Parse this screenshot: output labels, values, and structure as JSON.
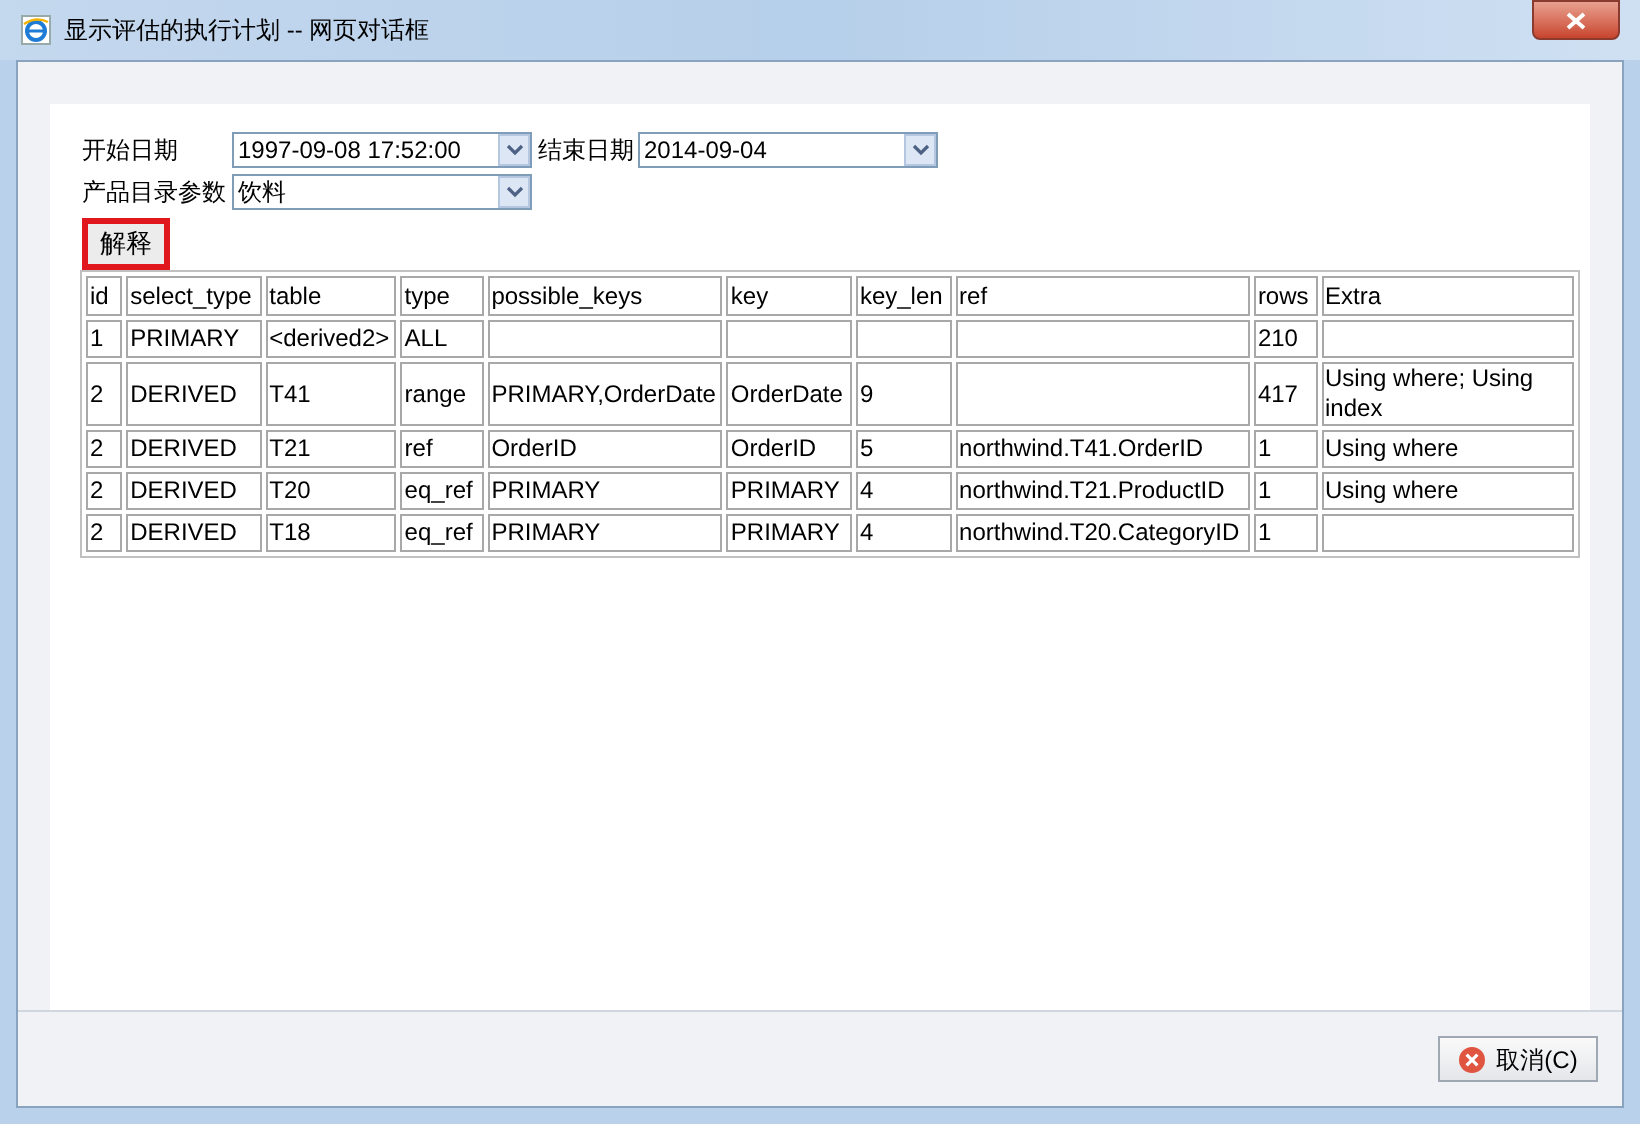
{
  "window": {
    "title": "显示评估的执行计划 -- 网页对话框"
  },
  "form": {
    "start_label": "开始日期",
    "start_value": "1997-09-08 17:52:00",
    "end_label": "结束日期",
    "end_value": "2014-09-04",
    "catalog_label": "产品目录参数",
    "catalog_value": "饮料"
  },
  "explain_button": {
    "label": "解释",
    "highlighted": true
  },
  "table": {
    "columns": [
      "id",
      "select_type",
      "table",
      "type",
      "possible_keys",
      "key",
      "key_len",
      "ref",
      "rows",
      "Extra"
    ],
    "rows": [
      [
        "1",
        "PRIMARY",
        "<derived2>",
        "ALL",
        "",
        "",
        "",
        "",
        "210",
        ""
      ],
      [
        "2",
        "DERIVED",
        "T41",
        "range",
        "PRIMARY,OrderDate",
        "OrderDate",
        "9",
        "",
        "417",
        "Using where; Using index"
      ],
      [
        "2",
        "DERIVED",
        "T21",
        "ref",
        "OrderID",
        "OrderID",
        "5",
        "northwind.T41.OrderID",
        "1",
        "Using where"
      ],
      [
        "2",
        "DERIVED",
        "T20",
        "eq_ref",
        "PRIMARY",
        "PRIMARY",
        "4",
        "northwind.T21.ProductID",
        "1",
        "Using where"
      ],
      [
        "2",
        "DERIVED",
        "T18",
        "eq_ref",
        "PRIMARY",
        "PRIMARY",
        "4",
        "northwind.T20.CategoryID",
        "1",
        ""
      ]
    ]
  },
  "cancel_button": {
    "label": "取消(C)"
  }
}
